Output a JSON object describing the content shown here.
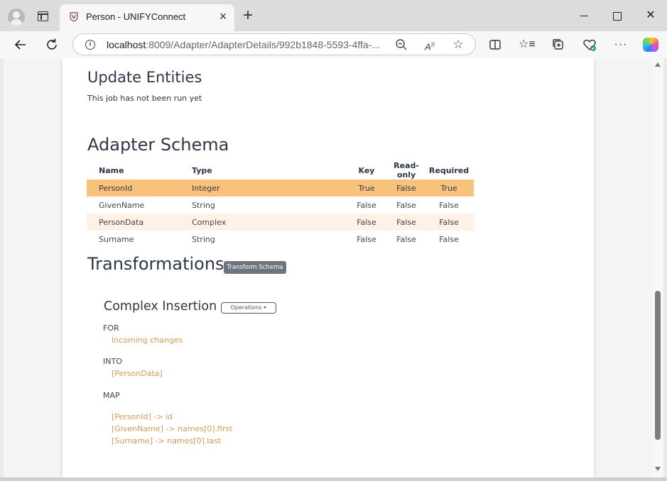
{
  "browser": {
    "tab_title": "Person - UNIFYConnect",
    "url_host": "localhost",
    "url_rest": ":8009/Adapter/AdapterDetails/992b1848-5593-4ffa-..."
  },
  "sections": {
    "update_entities": {
      "title": "Update Entities",
      "status": "This job has not been run yet"
    },
    "adapter_schema": {
      "title": "Adapter Schema",
      "columns": [
        "Name",
        "Type",
        "Key",
        "Read-only",
        "Required"
      ],
      "rows": [
        {
          "name": "PersonId",
          "type": "Integer",
          "key": "True",
          "read_only": "False",
          "required": "True",
          "selected": true
        },
        {
          "name": "GivenName",
          "type": "String",
          "key": "False",
          "read_only": "False",
          "required": "False"
        },
        {
          "name": "PersonData",
          "type": "Complex",
          "key": "False",
          "read_only": "False",
          "required": "False"
        },
        {
          "name": "Surname",
          "type": "String",
          "key": "False",
          "read_only": "False",
          "required": "False"
        }
      ]
    },
    "transformations": {
      "title": "Transformations",
      "button_label": "Transform Schema",
      "items": [
        {
          "title": "Complex Insertion",
          "ops_label": "Operations",
          "for_label": "FOR",
          "for_value": "Incoming changes",
          "into_label": "INTO",
          "into_value": "[PersonData]",
          "map_label": "MAP",
          "map": [
            "[PersonId] -> id",
            "[GivenName] -> names[0].first",
            "[Surname] -> names[0].last"
          ]
        }
      ]
    }
  },
  "colors": {
    "selected_row": "#f8c27c",
    "alt_row": "#fdf2e5",
    "value_text": "#d7995a",
    "secondary_button": "#6c757d"
  },
  "icons": {
    "titlebar": [
      "profile-icon",
      "tab-actions-icon",
      "favicon-icon",
      "close-icon",
      "plus-icon",
      "minimize-icon",
      "maximize-icon",
      "window-close-icon"
    ],
    "toolbar": [
      "back-icon",
      "reload-icon",
      "info-icon",
      "zoom-icon",
      "read-aloud-icon",
      "favorite-star-icon",
      "split-screen-icon",
      "favorites-icon",
      "collections-icon",
      "browser-essentials-icon",
      "more-icon",
      "copilot-icon"
    ]
  }
}
